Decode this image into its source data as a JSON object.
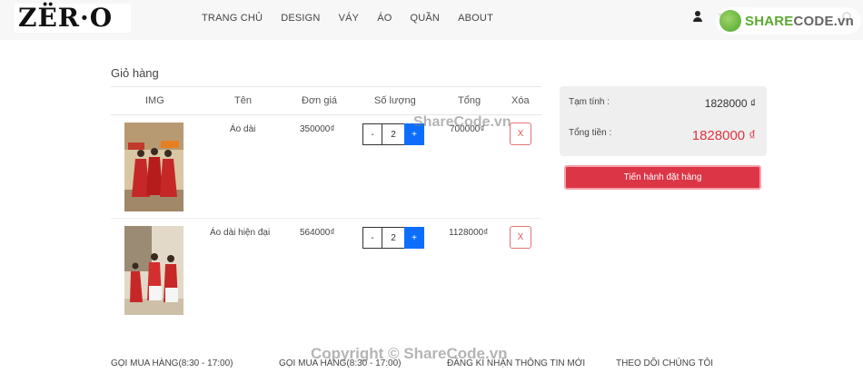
{
  "brand": {
    "logo_text": "ZËR·O"
  },
  "nav": [
    "TRANG CHỦ",
    "DESIGN",
    "VÁY",
    "ÁO",
    "QUẦN",
    "ABOUT"
  ],
  "cart": {
    "title": "Giỏ hàng",
    "headers": {
      "img": "IMG",
      "name": "Tên",
      "price": "Đơn giá",
      "qty": "Số lượng",
      "total": "Tổng",
      "delete": "Xóa"
    },
    "items": [
      {
        "name": "Áo dài",
        "price": "350000₫",
        "qty": "2",
        "total": "700000₫",
        "minus": "-",
        "plus": "+",
        "delete": "X"
      },
      {
        "name": "Áo dài hiện đại",
        "price": "564000₫",
        "qty": "2",
        "total": "1128000₫",
        "minus": "-",
        "plus": "+",
        "delete": "X"
      }
    ]
  },
  "summary": {
    "subtotal_label": "Tạm tính :",
    "subtotal_value": "1828000 ₫",
    "total_label": "Tổng tiền :",
    "total_value": "1828000 ₫",
    "checkout_label": "Tiến hành đặt hàng"
  },
  "footer": [
    "GỌI MUA HÀNG(8:30 - 17:00)",
    "GỌI MUA HÀNG(8:30 - 17:00)",
    "ĐĂNG KÍ NHẬN THÔNG TIN MỚI",
    "THEO DÕI CHÚNG TÔI"
  ],
  "watermark": {
    "mid": "ShareCode.vn",
    "bottom": "Copyright © ShareCode.vn",
    "logo_main": "SHARE",
    "logo_rest": "CODE.vn"
  },
  "colors": {
    "accent": "#0d6efd",
    "danger": "#dc3545",
    "total_red": "#e0333f",
    "header_bg": "#f7f7f7"
  }
}
